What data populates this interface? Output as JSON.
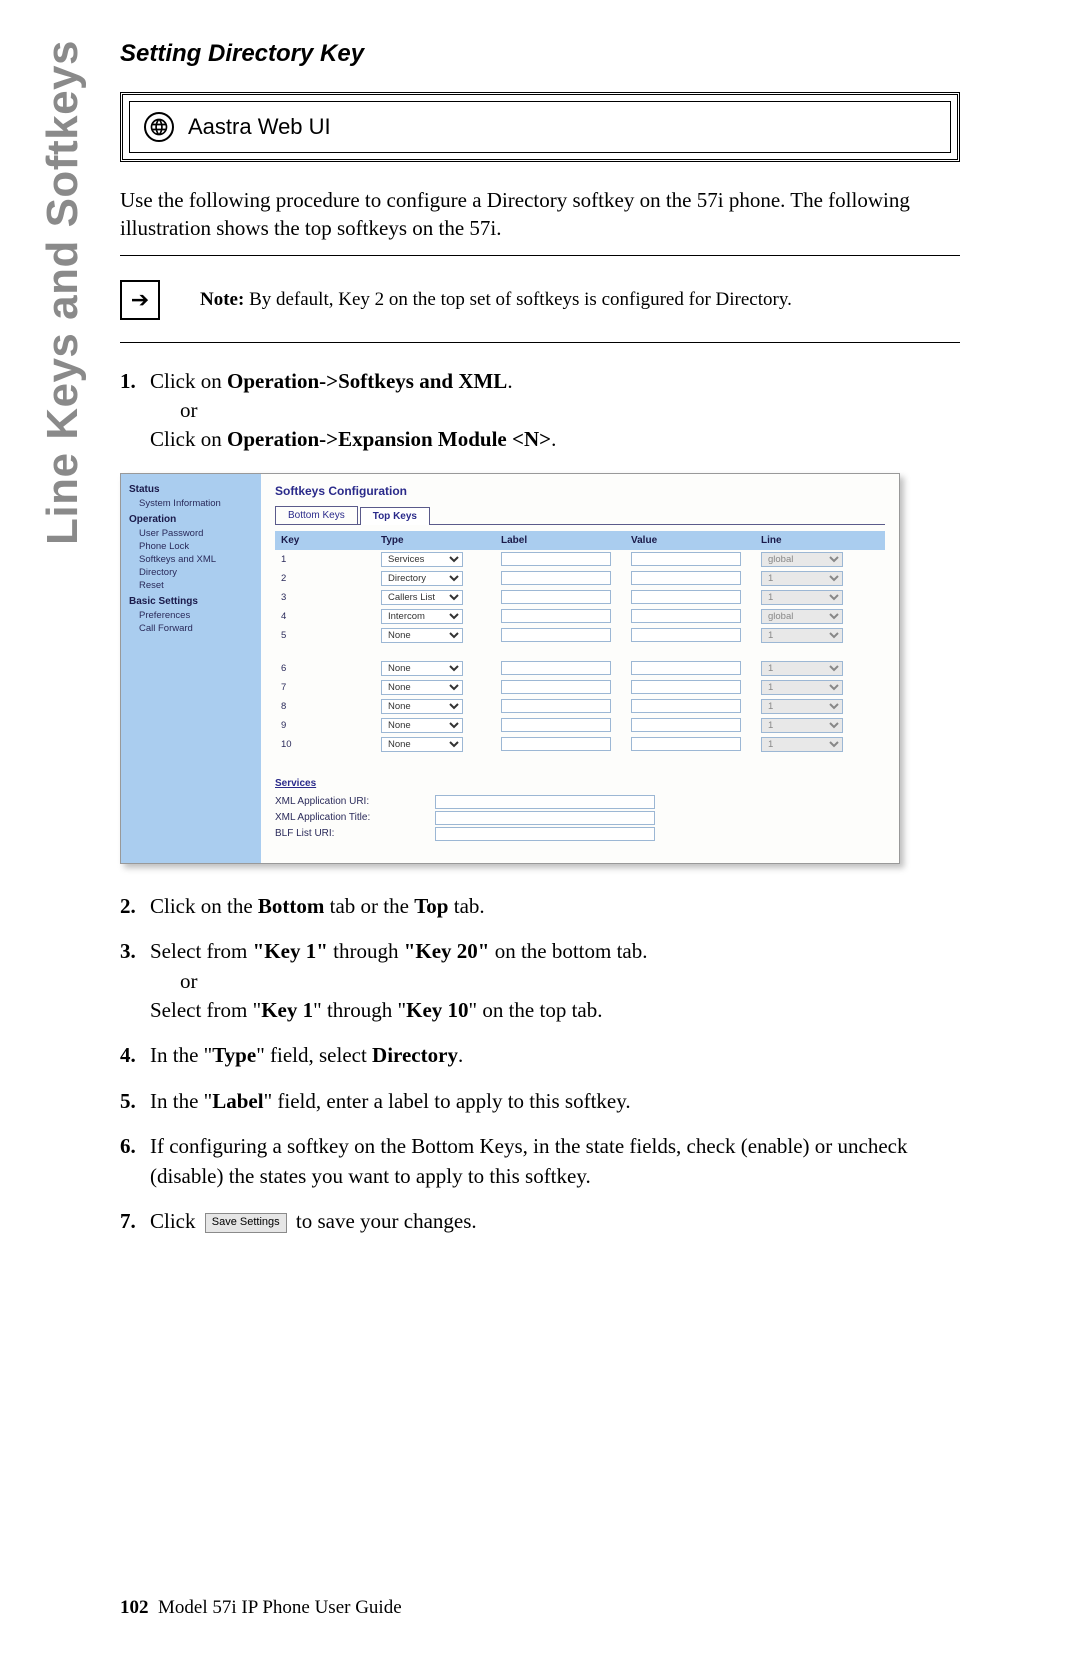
{
  "side_tab": "Line Keys and Softkeys",
  "section_title": "Setting Directory Key",
  "web_ui_label": "Aastra Web UI",
  "intro": "Use the following procedure to configure a Directory softkey on the 57i phone. The following illustration shows the top softkeys on the 57i.",
  "note_label": "Note:",
  "note_text": "By default, Key 2 on the top set of softkeys is configured for Directory.",
  "steps": {
    "s1a": "Click on ",
    "s1b": "Operation->Softkeys and XML",
    "s1c": "or",
    "s1d": "Click on ",
    "s1e": "Operation->Expansion Module <N>",
    "s2a": "Click on the ",
    "s2b": "Bottom",
    "s2c": " tab or the ",
    "s2d": "Top",
    "s2e": " tab.",
    "s3a": "Select from ",
    "s3b": "\"Key 1\"",
    "s3c": " through ",
    "s3d": "\"Key 20\"",
    "s3e": " on the bottom tab.",
    "s3f": "or",
    "s3g": "Select from \"",
    "s3h": "Key 1",
    "s3i": "\" through \"",
    "s3j": "Key 10",
    "s3k": "\" on the top tab.",
    "s4a": "In the \"",
    "s4b": "Type",
    "s4c": "\" field, select ",
    "s4d": "Directory",
    "s5a": "In the \"",
    "s5b": "Label",
    "s5c": "\" field, enter a label to apply to this softkey.",
    "s6": "If configuring a softkey on the Bottom Keys, in the state fields, check (enable) or uncheck (disable) the states you want to apply to this softkey.",
    "s7a": "Click",
    "s7b": "Save Settings",
    "s7c": "to save your changes."
  },
  "screenshot": {
    "sidebar": {
      "status": "Status",
      "system_info": "System Information",
      "operation": "Operation",
      "user_password": "User Password",
      "phone_lock": "Phone Lock",
      "softkeys_xml": "Softkeys and XML",
      "directory": "Directory",
      "reset": "Reset",
      "basic_settings": "Basic Settings",
      "preferences": "Preferences",
      "call_forward": "Call Forward"
    },
    "title": "Softkeys Configuration",
    "tabs": {
      "bottom": "Bottom Keys",
      "top": "Top Keys"
    },
    "headers": {
      "key": "Key",
      "type": "Type",
      "label": "Label",
      "value": "Value",
      "line": "Line"
    },
    "rows": [
      {
        "key": "1",
        "type": "Services",
        "line": "global",
        "line_disabled": true
      },
      {
        "key": "2",
        "type": "Directory",
        "line": "1",
        "line_disabled": true
      },
      {
        "key": "3",
        "type": "Callers List",
        "line": "1",
        "line_disabled": true
      },
      {
        "key": "4",
        "type": "Intercom",
        "line": "global",
        "line_disabled": true
      },
      {
        "key": "5",
        "type": "None",
        "line": "1",
        "line_disabled": true
      },
      {
        "key": "6",
        "type": "None",
        "line": "1",
        "line_disabled": true,
        "gap": true
      },
      {
        "key": "7",
        "type": "None",
        "line": "1",
        "line_disabled": true
      },
      {
        "key": "8",
        "type": "None",
        "line": "1",
        "line_disabled": true
      },
      {
        "key": "9",
        "type": "None",
        "line": "1",
        "line_disabled": true
      },
      {
        "key": "10",
        "type": "None",
        "line": "1",
        "line_disabled": true
      }
    ],
    "services": {
      "heading": "Services",
      "xml_uri": "XML Application URI:",
      "xml_title": "XML Application Title:",
      "blf": "BLF List URI:"
    }
  },
  "footer": {
    "page": "102",
    "title": "Model 57i IP Phone User Guide"
  }
}
